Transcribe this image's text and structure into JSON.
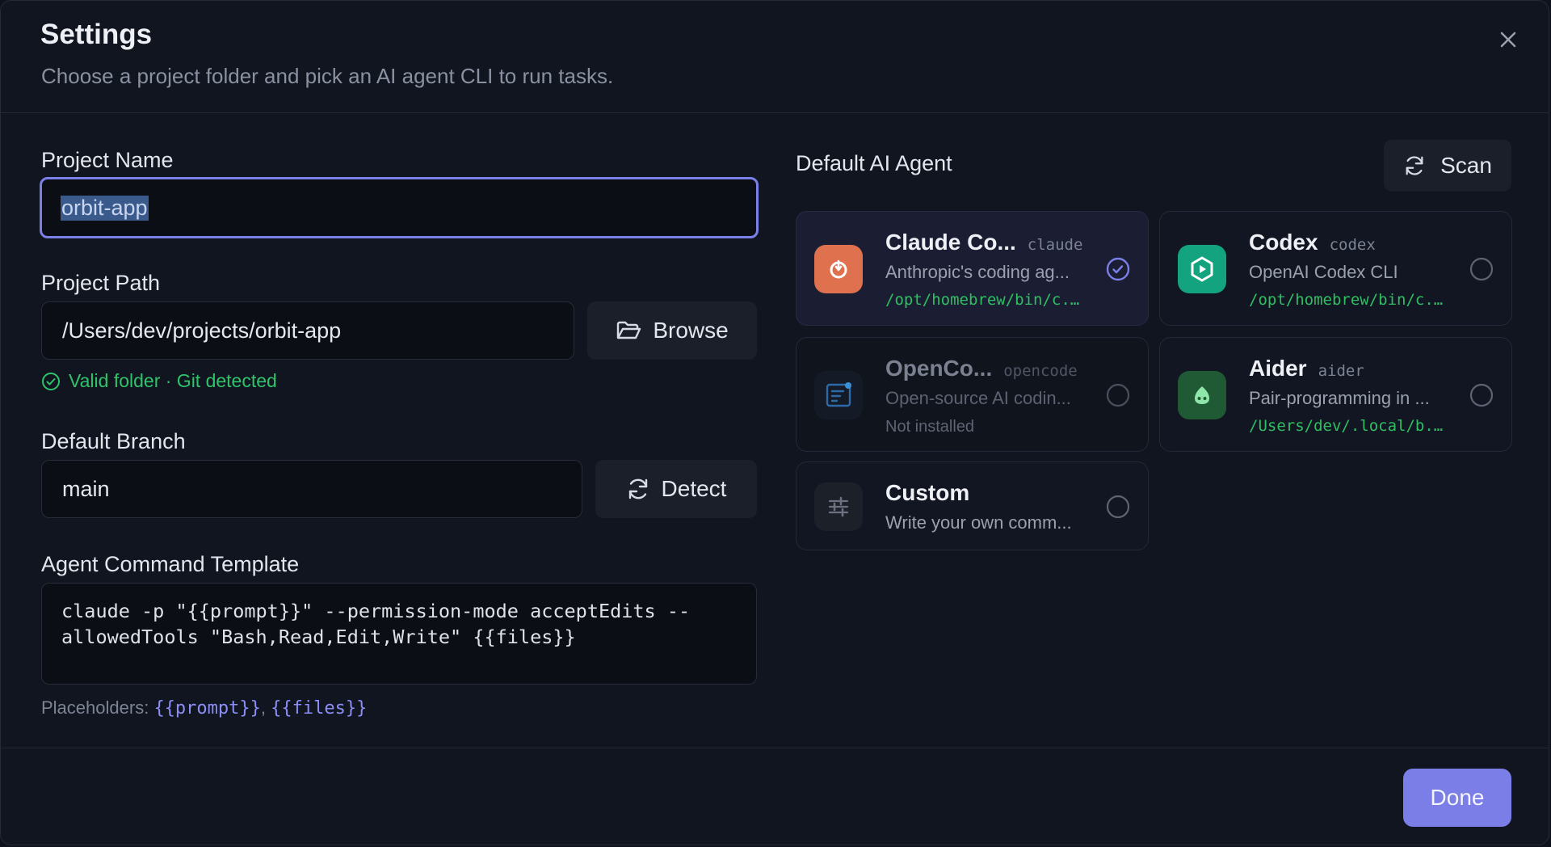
{
  "header": {
    "title": "Settings",
    "subtitle": "Choose a project folder and pick an AI agent CLI to run tasks."
  },
  "project_name": {
    "label": "Project Name",
    "value": "orbit-app"
  },
  "project_path": {
    "label": "Project Path",
    "value": "/Users/dev/projects/orbit-app",
    "browse_label": "Browse",
    "validation": "Valid folder · Git detected"
  },
  "default_branch": {
    "label": "Default Branch",
    "value": "main",
    "detect_label": "Detect"
  },
  "command_template": {
    "label": "Agent Command Template",
    "value": "claude -p \"{{prompt}}\" --permission-mode acceptEdits --\nallowedTools \"Bash,Read,Edit,Write\" {{files}}",
    "placeholders_label": "Placeholders:",
    "placeholder_1": "{{prompt}}",
    "separator": ",",
    "placeholder_2": "{{files}}"
  },
  "agents": {
    "title": "Default AI Agent",
    "scan_label": "Scan",
    "items": [
      {
        "name": "Claude Co...",
        "cmd": "claude",
        "desc": "Anthropic's coding ag...",
        "path": "/opt/homebrew/bin/c...",
        "selected": true,
        "color": "#e0714f"
      },
      {
        "name": "Codex",
        "cmd": "codex",
        "desc": "OpenAI Codex CLI",
        "path": "/opt/homebrew/bin/c...",
        "selected": false,
        "color": "#14a37f"
      },
      {
        "name": "OpenCo...",
        "cmd": "opencode",
        "desc": "Open-source AI codin...",
        "status": "Not installed",
        "selected": false,
        "color": "#1a2233"
      },
      {
        "name": "Aider",
        "cmd": "aider",
        "desc": "Pair-programming in ...",
        "path": "/Users/dev/.local/b...",
        "selected": false,
        "color": "#1f5a34"
      },
      {
        "name": "Custom",
        "desc": "Write your own comm...",
        "selected": false,
        "color": "#1c2029"
      }
    ]
  },
  "footer": {
    "done_label": "Done"
  },
  "colors": {
    "accent": "#7a7ee6",
    "success": "#2fc46a",
    "background": "#111520"
  }
}
